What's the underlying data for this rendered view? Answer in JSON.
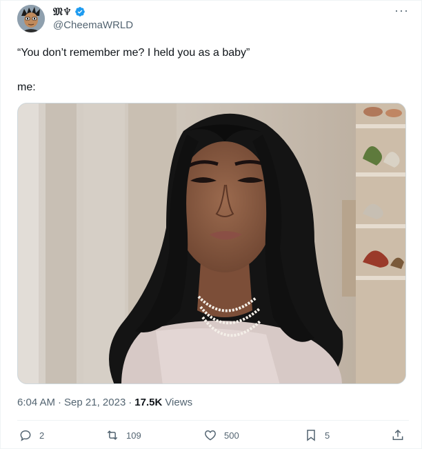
{
  "author": {
    "display_name": "𝔐♆",
    "handle": "@CheemaWRLD",
    "verified": true,
    "avatar_icon": "cartoon-avatar"
  },
  "more_icon": "more-dots-icon",
  "more_glyph": "···",
  "tweet": {
    "line1": "“You don’t remember me? I held you as a baby”",
    "line2": "me:"
  },
  "media": {
    "type": "photo",
    "subject": "woman-portrait-photo"
  },
  "meta": {
    "time": "6:04 AM",
    "sep1": "·",
    "date": "Sep 21, 2023",
    "sep2": "·",
    "views_count": "17.5K",
    "views_label": "Views"
  },
  "actions": {
    "reply_count": "2",
    "retweet_count": "109",
    "like_count": "500",
    "bookmark_count": "5"
  },
  "colors": {
    "text": "#0f1419",
    "secondary": "#536471",
    "verified": "#1d9bf0",
    "border": "#eff3f4"
  }
}
